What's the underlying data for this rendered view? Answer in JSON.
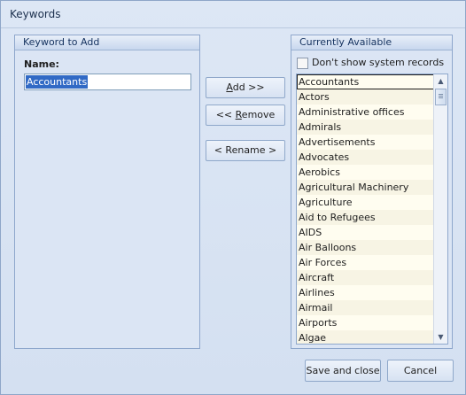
{
  "window": {
    "title": "Keywords"
  },
  "left_panel": {
    "header": "Keyword to Add",
    "name_label": "Name:",
    "name_value": "Accountants"
  },
  "buttons": {
    "add": "Add >>",
    "remove": "<< Remove",
    "rename": "< Rename >",
    "save_close": "Save and close",
    "cancel": "Cancel"
  },
  "right_panel": {
    "header": "Currently Available",
    "checkbox_label": "Don't show system records",
    "checkbox_checked": false,
    "selected_item": "Accountants",
    "items": [
      "Accountants",
      "Actors",
      "Administrative offices",
      "Admirals",
      "Advertisements",
      "Advocates",
      "Aerobics",
      "Agricultural Machinery",
      "Agriculture",
      "Aid to Refugees",
      "AIDS",
      "Air Balloons",
      "Air Forces",
      "Aircraft",
      "Airlines",
      "Airmail",
      "Airports",
      "Algae"
    ]
  },
  "icons": {
    "scroll_up": "triangle-up-icon",
    "scroll_down": "triangle-down-icon"
  }
}
